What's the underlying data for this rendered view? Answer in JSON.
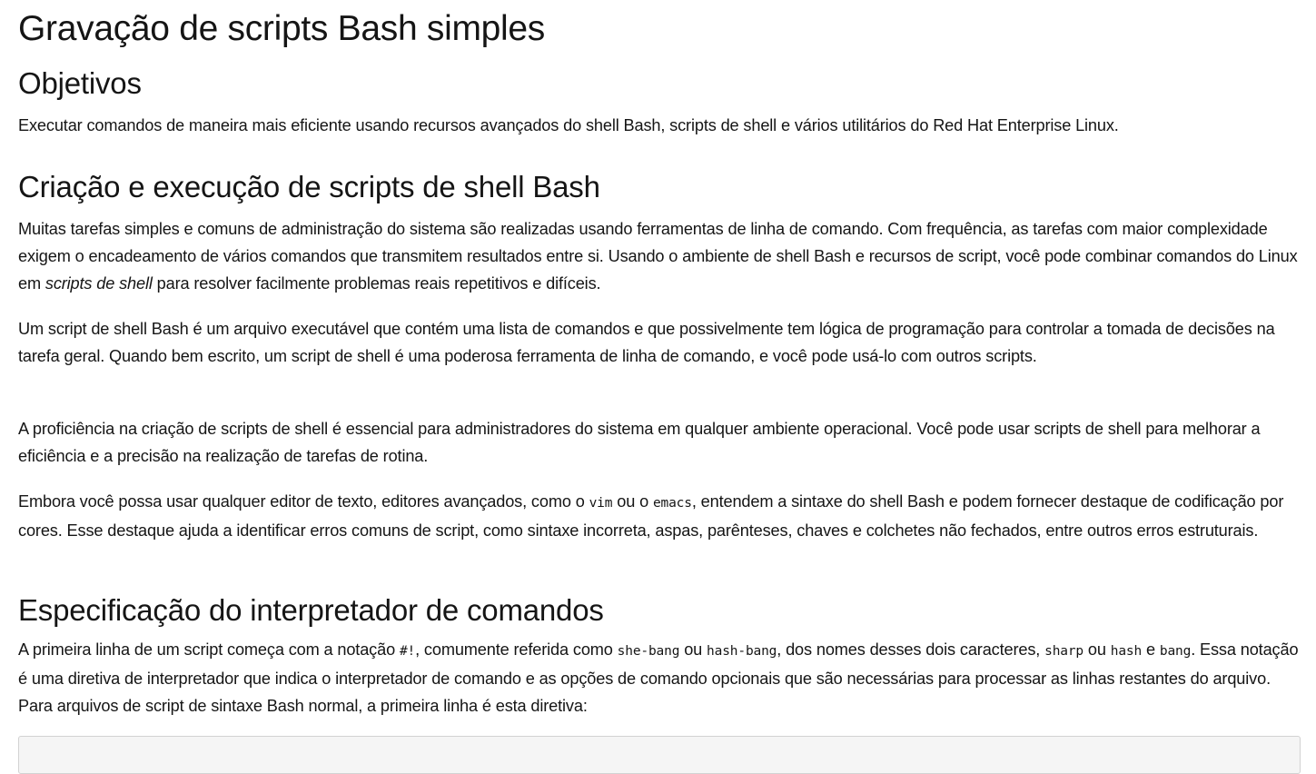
{
  "title": "Gravação de scripts Bash simples",
  "objectives": {
    "heading": "Objetivos",
    "text": "Executar comandos de maneira mais eficiente usando recursos avançados do shell Bash, scripts de shell e vários utilitários do Red Hat Enterprise Linux."
  },
  "section_creation": {
    "heading": "Criação e execução de scripts de shell Bash",
    "p1": {
      "before": "Muitas tarefas simples e comuns de administração do sistema são realizadas usando ferramentas de linha de comando. Com frequência, as tarefas com maior complexidade exigem o encadeamento de vários comandos que transmitem resultados entre si. Usando o ambiente de shell Bash e recursos de script, você pode combinar comandos do Linux em ",
      "emphasis": "scripts de shell",
      "after": " para resolver facilmente problemas reais repetitivos e difíceis."
    },
    "p2": "Um script de shell Bash é um arquivo executável que contém uma lista de comandos e que possivelmente tem lógica de programação para controlar a tomada de decisões na tarefa geral. Quando bem escrito, um script de shell é uma poderosa ferramenta de linha de comando, e você pode usá-lo com outros scripts.",
    "p3": "A proficiência na criação de scripts de shell é essencial para administradores do sistema em qualquer ambiente operacional. Você pode usar scripts de shell para melhorar a eficiência e a precisão na realização de tarefas de rotina.",
    "p4": {
      "t1": "Embora você possa usar qualquer editor de texto, editores avançados, como o ",
      "code1": "vim",
      "t2": " ou o ",
      "code2": "emacs",
      "t3": ", entendem a sintaxe do shell Bash e podem fornecer destaque de codificação por cores. Esse destaque ajuda a identificar erros comuns de script, como sintaxe incorreta, aspas, parênteses, chaves e colchetes não fechados, entre outros erros estruturais."
    }
  },
  "section_interpreter": {
    "heading": "Especificação do interpretador de comandos",
    "p1": {
      "t1": "A primeira linha de um script começa com a notação ",
      "code1": "#!",
      "t2": ", comumente referida como ",
      "code2": "she-bang",
      "t3": " ou ",
      "code3": "hash-bang",
      "t4": ", dos nomes desses dois caracteres, ",
      "code4": "sharp",
      "t5": " ou ",
      "code5": "hash",
      "t6": " e ",
      "code6": "bang",
      "t7": ". Essa notação é uma diretiva de interpretador que indica o interpretador de comando e as opções de comando opcionais que são necessárias para processar as linhas restantes do arquivo. Para arquivos de script de sintaxe Bash normal, a primeira linha é esta diretiva:"
    }
  }
}
